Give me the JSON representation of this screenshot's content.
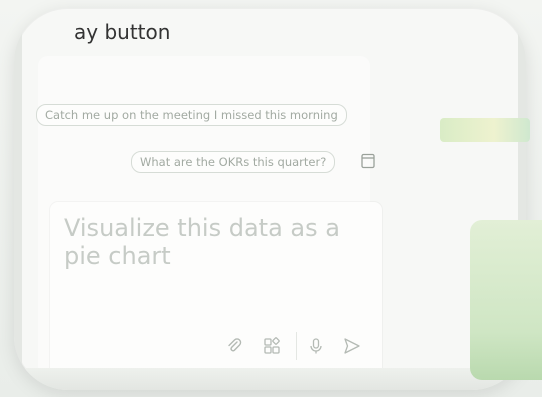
{
  "header": {
    "title": "ay button"
  },
  "suggestions": [
    {
      "label": "Catch me up on the meeting I missed this morning"
    },
    {
      "label": "What are the OKRs this quarter?"
    }
  ],
  "compose": {
    "placeholder": "Visualize this data as a pie chart"
  },
  "icons": {
    "tray": "notebook-icon",
    "attach": "paperclip-icon",
    "apps": "apps-icon",
    "mic": "microphone-icon",
    "send": "send-icon"
  },
  "colors": {
    "chip_border": "#d6dcd6",
    "chip_text": "#a2aaa2",
    "placeholder_text": "#c6cbc6",
    "icon_stroke": "#b4bab4",
    "accent_green": "#cfe6c4"
  }
}
